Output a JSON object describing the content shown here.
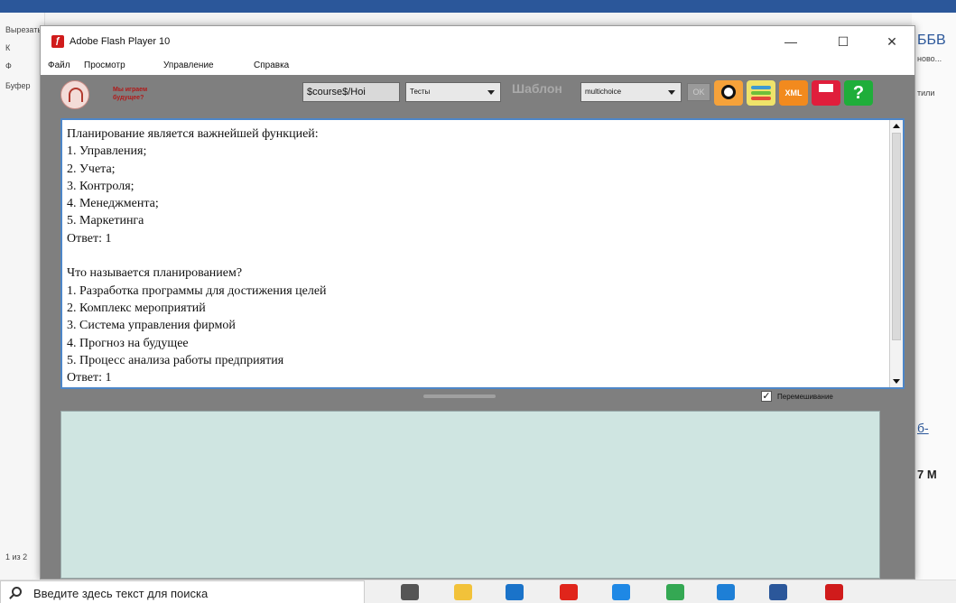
{
  "background_app": {
    "left_items": [
      "Вырезать",
      "К",
      "Ф",
      "Буфер",
      "1 из 2"
    ],
    "right_items": [
      "ББВ",
      "ново...",
      "тили",
      "б-",
      "7 М"
    ]
  },
  "window": {
    "title": "Adobe Flash Player 10",
    "minimize": "—",
    "maximize": "☐",
    "close": "✕",
    "menu": [
      "Файл",
      "Просмотр",
      "Управление",
      "Справка"
    ]
  },
  "toolbar": {
    "slogan_line1": "Мы играем",
    "slogan_line2": "будущее?",
    "course_field": "$course$/Hoi",
    "type_select": "Тесты",
    "template_label": "Шаблон",
    "template_select": "multichoice",
    "ok_label": "OK",
    "xml_label": "XML",
    "help_label": "?"
  },
  "editor": {
    "lines": [
      "Планирование является важнейшей функцией:",
      "1. Управления;",
      "2. Учета;",
      "3. Контроля;",
      "4. Менеджмента;",
      "5. Маркетинга",
      "Ответ: 1",
      "",
      "Что называется планированием?",
      "1. Разработка программы для достижения целей",
      "2. Комплекс мероприятий",
      "3. Система управления фирмой",
      "4. Прогноз на будущее",
      "5. Процесс анализа работы предприятия",
      "Ответ: 1"
    ]
  },
  "shuffle": {
    "checked": true,
    "label": "Перемешивание",
    "mark": "✓"
  },
  "taskbar": {
    "search_placeholder": "Введите здесь текст для поиска",
    "apps": [
      "task-view",
      "file-explorer",
      "mail",
      "yandex-browser",
      "app-circle",
      "chrome",
      "edge",
      "word",
      "flash-player"
    ],
    "app_colors": [
      "#555555",
      "#f2c23a",
      "#1a73c9",
      "#e0251b",
      "#1e88e5",
      "#34a853",
      "#1e7fd6",
      "#2b579a",
      "#d01b1b"
    ]
  }
}
